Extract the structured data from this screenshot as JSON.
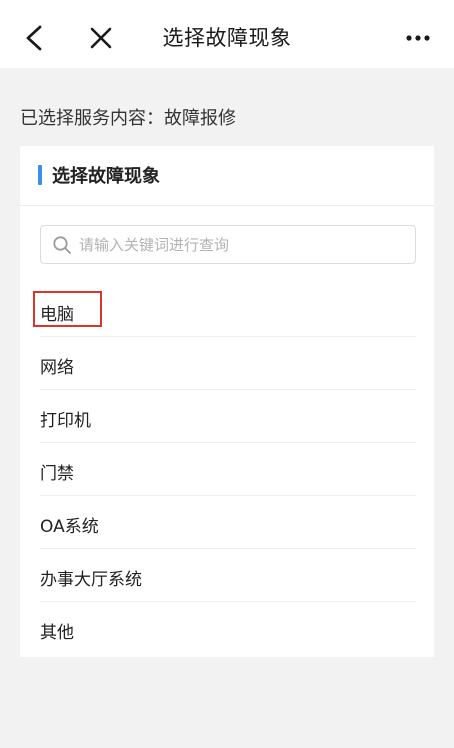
{
  "header": {
    "title": "选择故障现象",
    "back_icon": "chevron-left-icon",
    "close_icon": "close-icon",
    "more_icon": "more-horizontal-icon"
  },
  "service": {
    "text": "已选择服务内容：故障报修"
  },
  "card": {
    "title": "选择故障现象",
    "accent_color": "#3a8ee6"
  },
  "search": {
    "placeholder": "请输入关键词进行查询",
    "value": ""
  },
  "list": {
    "items": [
      {
        "label": "电脑"
      },
      {
        "label": "网络"
      },
      {
        "label": "打印机"
      },
      {
        "label": "门禁"
      },
      {
        "label": "OA系统"
      },
      {
        "label": "办事大厅系统"
      },
      {
        "label": "其他"
      }
    ],
    "highlight_color": "#d9362b"
  }
}
